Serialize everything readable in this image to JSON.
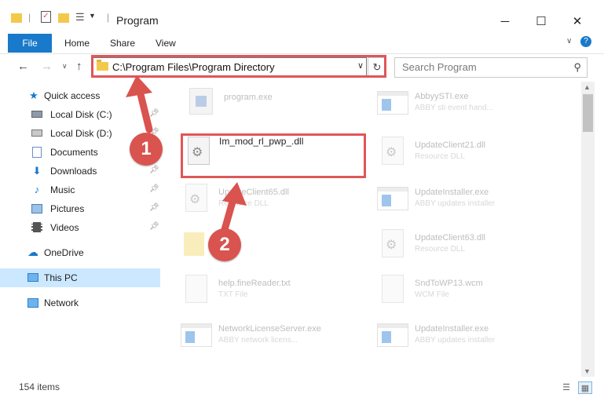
{
  "window": {
    "title": "Program"
  },
  "ribbon": {
    "file_label": "File",
    "tabs": [
      "Home",
      "Share",
      "View"
    ]
  },
  "address": {
    "path": "C:\\Program Files\\Program Directory"
  },
  "search": {
    "placeholder": "Search Program"
  },
  "sidebar": {
    "items": [
      {
        "label": "Quick access",
        "icon": "star-icon",
        "pinned": false
      },
      {
        "label": "Local Disk (C:)",
        "icon": "drive-icon",
        "pinned": true
      },
      {
        "label": "Local Disk (D:)",
        "icon": "drive-icon",
        "pinned": true
      },
      {
        "label": "Documents",
        "icon": "document-icon",
        "pinned": true
      },
      {
        "label": "Downloads",
        "icon": "download-icon",
        "pinned": true
      },
      {
        "label": "Music",
        "icon": "music-icon",
        "pinned": true
      },
      {
        "label": "Pictures",
        "icon": "picture-icon",
        "pinned": true
      },
      {
        "label": "Videos",
        "icon": "video-icon",
        "pinned": true
      },
      {
        "label": "OneDrive",
        "icon": "cloud-icon",
        "pinned": false
      },
      {
        "label": "This PC",
        "icon": "computer-icon",
        "pinned": false,
        "selected": true
      },
      {
        "label": "Network",
        "icon": "network-icon",
        "pinned": false
      }
    ]
  },
  "files": [
    {
      "name": "program.exe",
      "desc": "",
      "icon": "exe-icon"
    },
    {
      "name": "AbbyySTI.exe",
      "desc": "ABBY sti event hand...",
      "icon": "window-icon"
    },
    {
      "name": "Im_mod_rl_pwp_.dll",
      "desc": "",
      "icon": "gear-file-icon",
      "highlighted": true
    },
    {
      "name": "UpdateClient21.dll",
      "desc": "Resource DLL",
      "icon": "gear-file-icon"
    },
    {
      "name": "UpdateClient65.dll",
      "desc": "Resource DLL",
      "icon": "gear-file-icon"
    },
    {
      "name": "UpdateInstaller.exe",
      "desc": "ABBY updates installer",
      "icon": "window-icon"
    },
    {
      "name": "",
      "desc": "",
      "icon": "folder-icon"
    },
    {
      "name": "UpdateClient63.dll",
      "desc": "Resource DLL",
      "icon": "gear-file-icon"
    },
    {
      "name": "help.fineReader.txt",
      "desc": "TXT File",
      "icon": "text-file-icon"
    },
    {
      "name": "SndToWP13.wcm",
      "desc": "WCM File",
      "icon": "text-file-icon"
    },
    {
      "name": "NetworkLicenseServer.exe",
      "desc": "ABBY network licens...",
      "icon": "window-icon"
    },
    {
      "name": "UpdateInstaller.exe",
      "desc": "ABBY updates installer",
      "icon": "window-icon"
    }
  ],
  "status": {
    "items_count": "154 items"
  },
  "markers": [
    "1",
    "2"
  ],
  "colors": {
    "accent": "#1979ca",
    "highlight": "#e05658",
    "selection": "#cce8ff"
  }
}
